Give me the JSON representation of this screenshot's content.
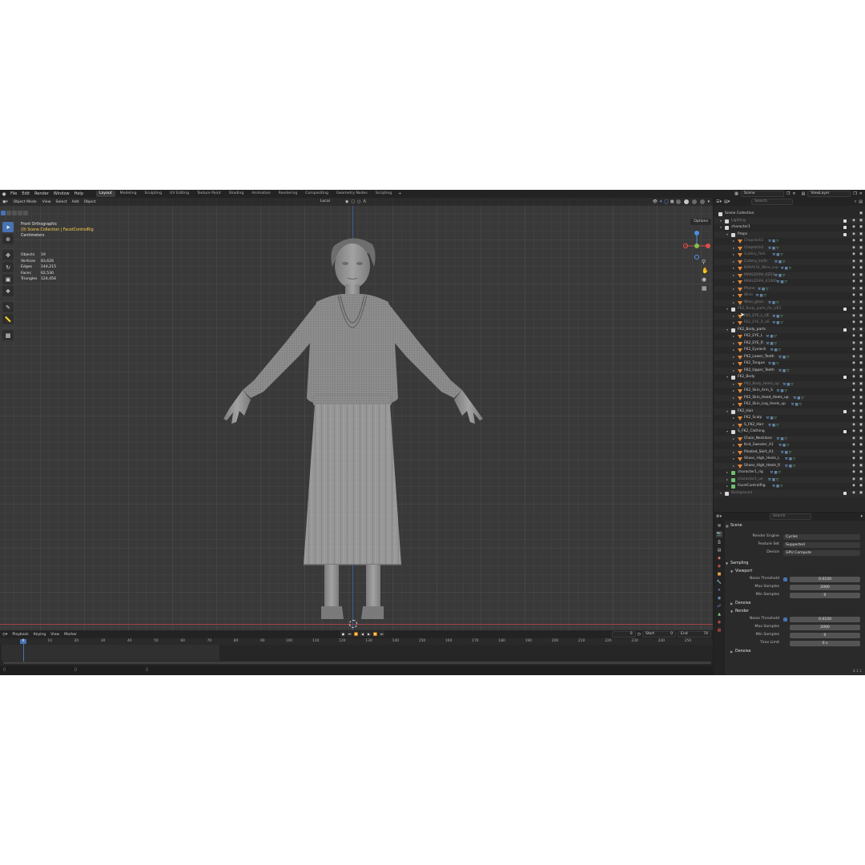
{
  "topbar": {
    "menus": [
      "File",
      "Edit",
      "Render",
      "Window",
      "Help"
    ],
    "workspaces": [
      "Layout",
      "Modeling",
      "Sculpting",
      "UV Editing",
      "Texture Paint",
      "Shading",
      "Animation",
      "Rendering",
      "Compositing",
      "Geometry Nodes",
      "Scripting"
    ],
    "active_workspace": "Layout",
    "scene_name": "Scene",
    "view_layer": "ViewLayer"
  },
  "viewport": {
    "mode": "Object Mode",
    "menus": [
      "View",
      "Select",
      "Add",
      "Object"
    ],
    "orientation": "Local",
    "options_label": "Options",
    "view_name": "Front Orthographic",
    "collection_path": "(0) Scene Collection | FacetControlRig",
    "units": "Centimeters",
    "stats": [
      {
        "label": "Objects",
        "value": "19"
      },
      {
        "label": "Vertices",
        "value": "83,626"
      },
      {
        "label": "Edges",
        "value": "144,215"
      },
      {
        "label": "Faces",
        "value": "62,530"
      },
      {
        "label": "Triangles",
        "value": "124,456"
      }
    ]
  },
  "timeline": {
    "menus": [
      "Playback",
      "Keying",
      "View",
      "Marker"
    ],
    "current_frame": "0",
    "start_label": "Start",
    "start_value": "0",
    "end_label": "End",
    "end_value": "74",
    "ticks": [
      "0",
      "10",
      "20",
      "30",
      "40",
      "50",
      "60",
      "70",
      "80",
      "90",
      "100",
      "110",
      "120",
      "130",
      "140",
      "150",
      "160",
      "170",
      "180",
      "190",
      "200",
      "210",
      "220",
      "230",
      "240",
      "250"
    ]
  },
  "outliner": {
    "search_placeholder": "Search",
    "rows": [
      {
        "label": "Scene Collection",
        "depth": 0,
        "type": "root",
        "dim": false
      },
      {
        "label": "Lighting",
        "depth": 1,
        "type": "coll",
        "dim": true
      },
      {
        "label": "character1",
        "depth": 1,
        "type": "coll",
        "dim": false
      },
      {
        "label": "Props",
        "depth": 2,
        "type": "coll",
        "dim": false
      },
      {
        "label": "Chopstick1",
        "depth": 3,
        "type": "mesh",
        "dim": true
      },
      {
        "label": "Chopstick2",
        "depth": 3,
        "type": "mesh",
        "dim": true
      },
      {
        "label": "Cutlery_fork",
        "depth": 3,
        "type": "mesh",
        "dim": true
      },
      {
        "label": "Cutlery_knife",
        "depth": 3,
        "type": "mesh",
        "dim": true
      },
      {
        "label": "KORACHI_Wine_cup",
        "depth": 3,
        "type": "mesh",
        "dim": true
      },
      {
        "label": "MAKUZARA_KZ03",
        "depth": 3,
        "type": "mesh",
        "dim": true
      },
      {
        "label": "MAKUZARA_K1000",
        "depth": 3,
        "type": "mesh",
        "dim": true
      },
      {
        "label": "Phone",
        "depth": 3,
        "type": "mesh",
        "dim": true
      },
      {
        "label": "Wine",
        "depth": 3,
        "type": "mesh",
        "dim": true
      },
      {
        "label": "Wine_glass",
        "depth": 3,
        "type": "mesh",
        "dim": true
      },
      {
        "label": "FK2_Body_parts_for_UE5",
        "depth": 2,
        "type": "coll",
        "dim": true
      },
      {
        "label": "FK2_EYE_L_UE",
        "depth": 3,
        "type": "mesh",
        "dim": true
      },
      {
        "label": "FK2_EYE_R_UE",
        "depth": 3,
        "type": "mesh",
        "dim": true
      },
      {
        "label": "FK2_Body_parts",
        "depth": 2,
        "type": "coll",
        "dim": false
      },
      {
        "label": "FK2_EYE_L",
        "depth": 3,
        "type": "mesh",
        "dim": false
      },
      {
        "label": "FK2_EYE_R",
        "depth": 3,
        "type": "mesh",
        "dim": false
      },
      {
        "label": "FK2_Eyelash",
        "depth": 3,
        "type": "mesh",
        "dim": false
      },
      {
        "label": "FK2_Lower_Teeth",
        "depth": 3,
        "type": "mesh",
        "dim": false
      },
      {
        "label": "FK2_Tongue",
        "depth": 3,
        "type": "mesh",
        "dim": false
      },
      {
        "label": "FK2_Upper_Teeth",
        "depth": 3,
        "type": "mesh",
        "dim": false
      },
      {
        "label": "FK2_Body",
        "depth": 2,
        "type": "coll",
        "dim": false
      },
      {
        "label": "FK2_Body_Heels_up",
        "depth": 3,
        "type": "mesh",
        "dim": true
      },
      {
        "label": "FK2_Skin_Arm_S",
        "depth": 3,
        "type": "mesh",
        "dim": false
      },
      {
        "label": "FK2_Skin_Head_Heels_up",
        "depth": 3,
        "type": "mesh",
        "dim": false
      },
      {
        "label": "FK2_Skin_Leg_Heels_up",
        "depth": 3,
        "type": "mesh",
        "dim": false
      },
      {
        "label": "FK2_Hair",
        "depth": 2,
        "type": "coll",
        "dim": false
      },
      {
        "label": "FK2_Scalp",
        "depth": 3,
        "type": "mesh",
        "dim": false
      },
      {
        "label": "S_FK2_Hair",
        "depth": 3,
        "type": "mesh",
        "dim": false
      },
      {
        "label": "S_FK2_Clothing",
        "depth": 2,
        "type": "coll",
        "dim": false
      },
      {
        "label": "Chain_Necklace",
        "depth": 3,
        "type": "mesh",
        "dim": false
      },
      {
        "label": "Knit_Sweater_A1",
        "depth": 3,
        "type": "mesh",
        "dim": false
      },
      {
        "label": "Pleated_Skirt_A1",
        "depth": 3,
        "type": "mesh",
        "dim": false
      },
      {
        "label": "Shoes_High_Heels_L",
        "depth": 3,
        "type": "mesh",
        "dim": false
      },
      {
        "label": "Shoes_High_Heels_R",
        "depth": 3,
        "type": "mesh",
        "dim": false
      },
      {
        "label": "character1_rig",
        "depth": 2,
        "type": "arm",
        "dim": false
      },
      {
        "label": "character1_ue",
        "depth": 2,
        "type": "arm",
        "dim": true
      },
      {
        "label": "FacetControlRig",
        "depth": 2,
        "type": "arm",
        "dim": false
      },
      {
        "label": "Background",
        "depth": 1,
        "type": "coll",
        "dim": true
      }
    ]
  },
  "properties": {
    "search_placeholder": "Search",
    "context": "Scene",
    "render_engine_label": "Render Engine",
    "render_engine": "Cycles",
    "feature_set_label": "Feature Set",
    "feature_set": "Supported",
    "device_label": "Device",
    "device": "GPU Compute",
    "sampling_label": "Sampling",
    "viewport_label": "Viewport",
    "noise_threshold_label": "Noise Threshold",
    "viewport_noise_threshold": "0.0100",
    "max_samples_label": "Max Samples",
    "viewport_max_samples": "2000",
    "min_samples_label": "Min Samples",
    "viewport_min_samples": "0",
    "denoise_label": "Denoise",
    "render_label": "Render",
    "render_noise_threshold": "0.0100",
    "render_max_samples": "2000",
    "render_min_samples": "0",
    "time_limit_label": "Time Limit",
    "render_time_limit": "0 s",
    "version": "4.1.1"
  },
  "colors": {
    "accent": "#4772b3",
    "collection_highlight": "#ffd24d",
    "axis_x": "#e44b4b",
    "axis_y": "#7fc34a",
    "axis_z": "#4b8ee4"
  }
}
